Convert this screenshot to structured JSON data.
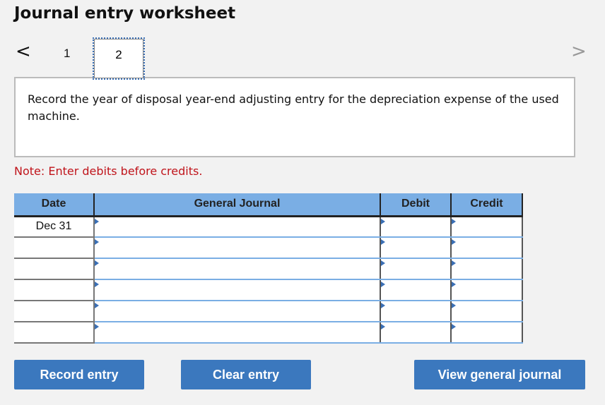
{
  "title": "Journal entry worksheet",
  "nav": {
    "prev_icon": "chevron-left-icon",
    "next_icon": "chevron-right-icon",
    "prev": "<",
    "next": ">",
    "tabs": [
      "1",
      "2"
    ],
    "active_tab": "2"
  },
  "prompt": "Record the year of disposal year-end adjusting entry for the depreciation expense of the used machine.",
  "note": "Note: Enter debits before credits.",
  "table": {
    "headers": [
      "Date",
      "General Journal",
      "Debit",
      "Credit"
    ],
    "rows": [
      {
        "date": "Dec 31"
      },
      {
        "date": ""
      },
      {
        "date": ""
      },
      {
        "date": ""
      },
      {
        "date": ""
      },
      {
        "date": ""
      }
    ]
  },
  "buttons": {
    "record": "Record entry",
    "clear": "Clear entry",
    "view": "View general journal"
  },
  "colors": {
    "accent": "#3b78be",
    "header": "#7aaee4",
    "note": "#c0141b"
  }
}
